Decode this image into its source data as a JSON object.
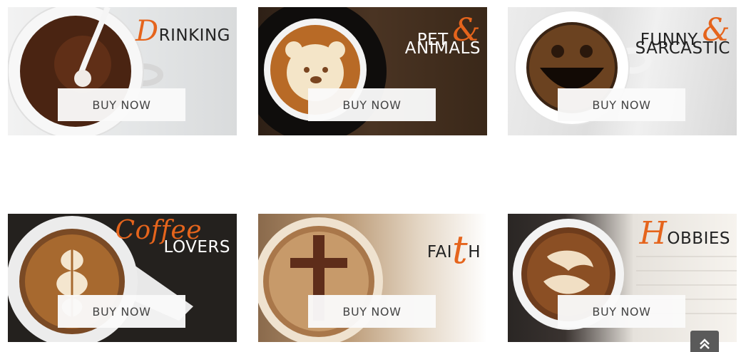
{
  "products": [
    {
      "title_script": "D",
      "title_rest": "RINKING",
      "button": "BUY NOW"
    },
    {
      "title_line1": "PET",
      "title_script": "&",
      "title_line2": "ANIMALS",
      "button": "BUY NOW"
    },
    {
      "title_line1": "FUNNY",
      "title_script": "&",
      "title_line2": "SARCASTIC",
      "button": "BUY NOW"
    },
    {
      "title_script": "Coffee",
      "title_line2": "LOVERS",
      "button": "BUY NOW"
    },
    {
      "title_pre": "FAI",
      "title_script": "t",
      "title_post": "H",
      "button": "BUY NOW"
    },
    {
      "title_script": "H",
      "title_rest": "OBBIES",
      "button": "BUY NOW"
    }
  ],
  "colors": {
    "accent": "#e5641c",
    "button_bg": "#fafafa",
    "scroll_top_bg": "#5a5a5a"
  },
  "icons": {
    "scroll_top": "double-chevron-up-icon"
  }
}
